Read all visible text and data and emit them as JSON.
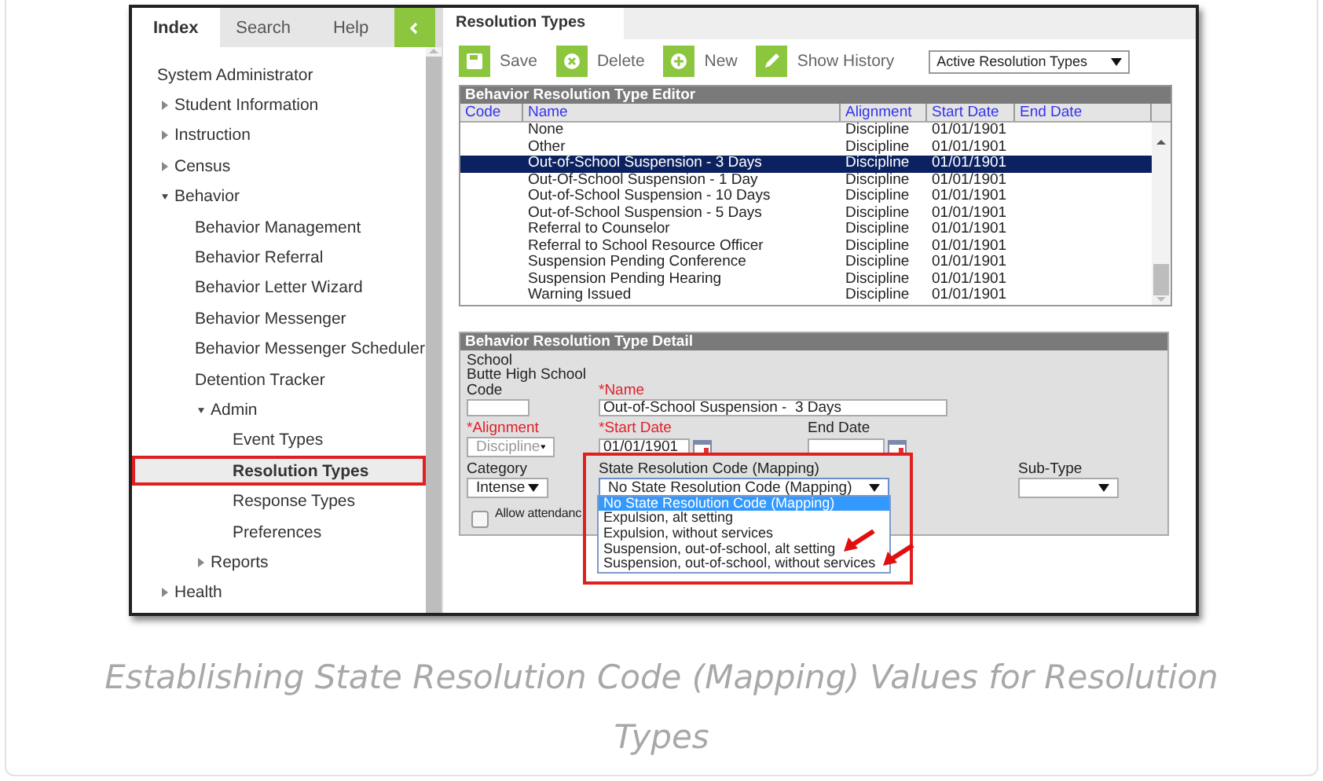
{
  "sidebar": {
    "tabs": [
      {
        "label": "Index",
        "selected": true
      },
      {
        "label": "Search",
        "selected": false
      },
      {
        "label": "Help",
        "selected": false
      }
    ],
    "tree": [
      {
        "label": "System Administrator",
        "selected": false,
        "children": [
          {
            "label": "Student Information",
            "selected": false,
            "expanded": false
          },
          {
            "label": "Instruction",
            "selected": false,
            "expanded": false
          },
          {
            "label": "Census",
            "selected": false,
            "expanded": false
          },
          {
            "label": "Behavior",
            "selected": false,
            "expanded": true,
            "children": [
              {
                "label": "Behavior Management",
                "selected": false
              },
              {
                "label": "Behavior Referral",
                "selected": false
              },
              {
                "label": "Behavior Letter Wizard",
                "selected": false
              },
              {
                "label": "Behavior Messenger",
                "selected": false
              },
              {
                "label": "Behavior Messenger Scheduler",
                "selected": false
              },
              {
                "label": "Detention Tracker",
                "selected": false
              },
              {
                "label": "Admin",
                "selected": false,
                "expanded": true,
                "children": [
                  {
                    "label": "Event Types",
                    "selected": false
                  },
                  {
                    "label": "Resolution Types",
                    "selected": true
                  },
                  {
                    "label": "Response Types",
                    "selected": false
                  },
                  {
                    "label": "Preferences",
                    "selected": false
                  }
                ]
              },
              {
                "label": "Reports",
                "selected": false,
                "expanded": false
              }
            ]
          },
          {
            "label": "Health",
            "selected": false,
            "expanded": false
          }
        ]
      }
    ]
  },
  "page_tab": "Resolution Types",
  "toolbar": {
    "buttons": [
      {
        "label": "Save",
        "kind": "save"
      },
      {
        "label": "Delete",
        "kind": "delete"
      },
      {
        "label": "New",
        "kind": "new"
      },
      {
        "label": "Show History",
        "kind": "history"
      }
    ],
    "filter": "Active Resolution Types"
  },
  "editor": {
    "title": "Behavior Resolution Type Editor",
    "columns": [
      "Code",
      "Name",
      "Alignment",
      "Start Date",
      "End Date"
    ],
    "rows": [
      {
        "name": "None",
        "alignment": "Discipline",
        "start_date": "01/01/1901",
        "selected": false
      },
      {
        "name": "Other",
        "alignment": "Discipline",
        "start_date": "01/01/1901",
        "selected": false
      },
      {
        "name": "Out-of-School Suspension - 3 Days",
        "alignment": "Discipline",
        "start_date": "01/01/1901",
        "selected": true
      },
      {
        "name": "Out-Of-School Suspension - 1 Day",
        "alignment": "Discipline",
        "start_date": "01/01/1901",
        "selected": false
      },
      {
        "name": "Out-of-School Suspension - 10 Days",
        "alignment": "Discipline",
        "start_date": "01/01/1901",
        "selected": false
      },
      {
        "name": "Out-of-School Suspension - 5 Days",
        "alignment": "Discipline",
        "start_date": "01/01/1901",
        "selected": false
      },
      {
        "name": "Referral to Counselor",
        "alignment": "Discipline",
        "start_date": "01/01/1901",
        "selected": false
      },
      {
        "name": "Referral to School Resource Officer",
        "alignment": "Discipline",
        "start_date": "01/01/1901",
        "selected": false
      },
      {
        "name": "Suspension Pending Conference",
        "alignment": "Discipline",
        "start_date": "01/01/1901",
        "selected": false
      },
      {
        "name": "Suspension Pending Hearing",
        "alignment": "Discipline",
        "start_date": "01/01/1901",
        "selected": false
      },
      {
        "name": "Warning Issued",
        "alignment": "Discipline",
        "start_date": "01/01/1901",
        "selected": false
      }
    ]
  },
  "detail": {
    "title": "Behavior Resolution Type Detail",
    "school_label": "School",
    "school_name": "Butte High School",
    "code": {
      "label": "Code",
      "required": false
    },
    "name": {
      "label": "*Name",
      "required": true,
      "value": "Out-of-School Suspension -  3 Days"
    },
    "alignment": {
      "label": "*Alignment",
      "required": true,
      "value": "Discipline",
      "disabled": true
    },
    "start_date": {
      "label": "*Start Date",
      "required": true,
      "value": "01/01/1901"
    },
    "end_date": {
      "label": "End Date",
      "required": false
    },
    "category": {
      "label": "Category",
      "required": false,
      "value": "Intense"
    },
    "state_code": {
      "label": "State Resolution Code (Mapping)",
      "required": false,
      "value": "No State Resolution Code (Mapping)",
      "expanded": true,
      "options": [
        {
          "label": "No State Resolution Code (Mapping)",
          "selected": true,
          "marked": false
        },
        {
          "label": "Expulsion, alt setting",
          "selected": false,
          "marked": false
        },
        {
          "label": "Expulsion, without services",
          "selected": false,
          "marked": false
        },
        {
          "label": "Suspension, out-of-school, alt setting",
          "selected": false,
          "marked": true
        },
        {
          "label": "Suspension, out-of-school, without services",
          "selected": false,
          "marked": true
        }
      ]
    },
    "sub_type": {
      "label": "Sub-Type",
      "required": false
    },
    "allow_attendance": {
      "label": "Allow attendanc",
      "checked": false
    }
  },
  "caption": "Establishing State Resolution Code (Mapping) Values for Resolution Types"
}
